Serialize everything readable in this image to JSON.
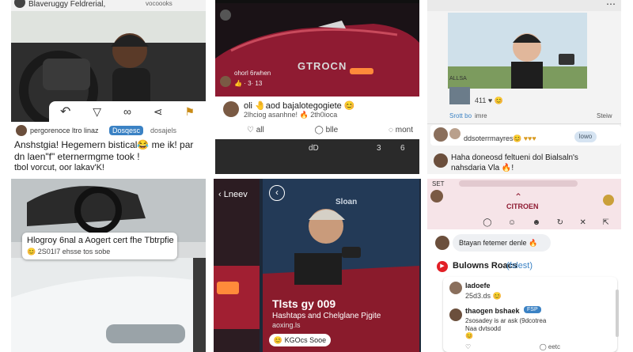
{
  "tile1": {
    "header_text": "Blaveruggy Feldrerial,",
    "header_right": "vocoooks",
    "action_icons": [
      "share-arrow-icon",
      "triangle-icon",
      "link-icon",
      "share-icon",
      "flag-icon"
    ],
    "username": "pergorenoce ltro linaz",
    "badge": "Dosqesc",
    "username_right": "dosajels",
    "caption_line1": "Anshstgia! Hegemern bistical😂 me ik! par",
    "caption_line2": "dn laen\"f\" eternermgme took !",
    "caption_line3": "tbol vorcut, oor lakav'K!"
  },
  "tile2": {
    "brand": "GTROCN",
    "overlay_line1": "ohorl 6rwhen",
    "overlay_line2": "👍 · 3· 13",
    "post_title": "oli 🤚aod bajalotegogiete 😊",
    "post_sub": "2lhciog asanhne! 🔥 2th0ioca",
    "action_all": "all",
    "action_bile": "blle",
    "action_mont": "mont",
    "stat_left": "dD",
    "stat_mid": "3",
    "stat_right": "6"
  },
  "tile3": {
    "photo_caption": "ALLSA",
    "mini_label": "411 ♥ 😊",
    "tab_active": "Srott bo",
    "tab_second": "imre",
    "tab_right": "Steiw",
    "comment_name": "ddsoterrmayres",
    "comment_meta": "😊 ♥♥♥",
    "comment_pill": "lowo",
    "post_line1": "Haha doneosd feltueni dol Bialsaln's",
    "post_line2": "nahsdaria Vla 🔥!"
  },
  "tile4": {
    "title": "Hlogroy 6nal a Aogert cert fhe Tbtrpfie",
    "sub": "😊 2S01I7 ehsse tos sobe"
  },
  "tile5": {
    "back_label": "Lneev",
    "brand": "Sloan",
    "headline": "Tlsts gy 009",
    "desc_line1": "Hashtaps and Chelglane Pjgite",
    "desc_line2": "aoxing.ls",
    "reaction": "😊 KGOcs Sooe"
  },
  "tile6": {
    "status_left": "SET",
    "brand": "CITROEN",
    "bubble_text": "Btayan fetemer denle 🔥",
    "section_title": "Bulowns Roacs",
    "section_tag": "(fslest)",
    "c1_name": "ladoefe",
    "c1_meta": "25d3.ds 😊",
    "c2_name": "thaogen bshaek",
    "c2_badge": "FSP",
    "c2_line1": "2sosadey is ar ask (9dcotrea",
    "c2_line2": "Naa dvtsodd",
    "c2_react": "😊",
    "c2_footer": "eetc"
  },
  "colors": {
    "card_bg": "#ffffff",
    "link_blue": "#3b82c4",
    "car_red": "#8f1b32",
    "dark_interior": "#2b2b2b",
    "youtube_red": "#e21f26"
  }
}
